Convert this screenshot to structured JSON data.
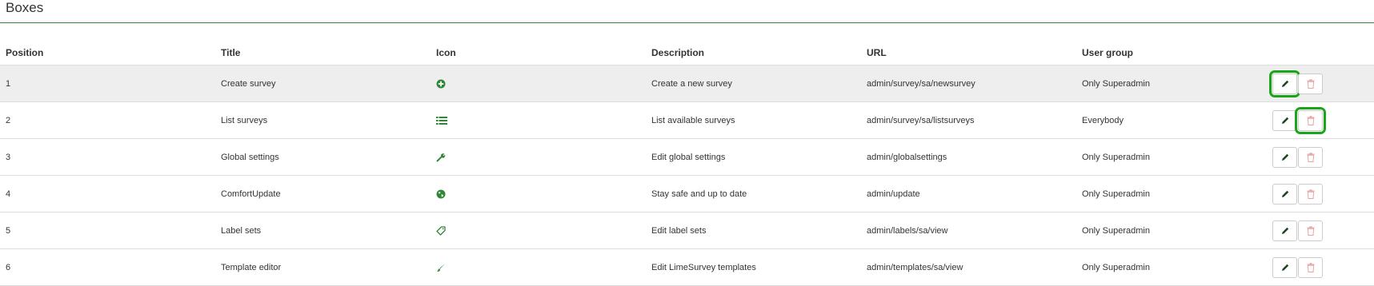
{
  "page": {
    "title": "Boxes"
  },
  "table": {
    "headers": [
      "Position",
      "Title",
      "Icon",
      "Description",
      "URL",
      "User group"
    ],
    "rows": [
      {
        "position": "1",
        "title": "Create survey",
        "icon": "add-circle-icon",
        "description": "Create a new survey",
        "url": "admin/survey/sa/newsurvey",
        "group": "Only Superadmin"
      },
      {
        "position": "2",
        "title": "List surveys",
        "icon": "list-icon",
        "description": "List available surveys",
        "url": "admin/survey/sa/listsurveys",
        "group": "Everybody"
      },
      {
        "position": "3",
        "title": "Global settings",
        "icon": "wrench-icon",
        "description": "Edit global settings",
        "url": "admin/globalsettings",
        "group": "Only Superadmin"
      },
      {
        "position": "4",
        "title": "ComfortUpdate",
        "icon": "globe-icon",
        "description": "Stay safe and up to date",
        "url": "admin/update",
        "group": "Only Superadmin"
      },
      {
        "position": "5",
        "title": "Label sets",
        "icon": "tag-icon",
        "description": "Edit label sets",
        "url": "admin/labels/sa/view",
        "group": "Only Superadmin"
      },
      {
        "position": "6",
        "title": "Template editor",
        "icon": "brush-icon",
        "description": "Edit LimeSurvey templates",
        "url": "admin/templates/sa/view",
        "group": "Only Superadmin"
      }
    ]
  },
  "actions": {
    "edit_icon": "pencil-icon",
    "delete_icon": "trash-icon"
  },
  "colors": {
    "accent": "#328637",
    "delete": "#d9534f",
    "highlight": "#1aa51a",
    "row_highlight": "#eeeeee"
  }
}
